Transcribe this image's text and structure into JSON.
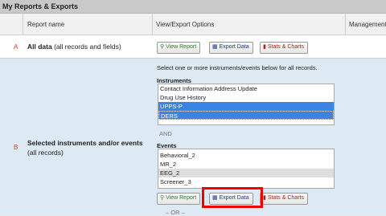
{
  "title": "My Reports & Exports",
  "columns": {
    "report_name": "Report name",
    "view_export": "View/Export Options",
    "management": "Management"
  },
  "rows": {
    "a": {
      "letter": "A",
      "name_bold": "All data",
      "name_rest": " (all records and fields)"
    },
    "b": {
      "letter": "B",
      "name_bold": "Selected instruments and/or events",
      "name_rest": "(all records)"
    }
  },
  "buttons": {
    "view_report": "View Report",
    "export_data": "Export Data",
    "stats_charts": "Stats & Charts"
  },
  "selection": {
    "instructions": "Select one or more instruments/events below for all records.",
    "instruments_label": "Instruments",
    "instruments": [
      {
        "label": "Contact Information Address Update",
        "selected": false
      },
      {
        "label": "Drug Use History",
        "selected": false
      },
      {
        "label": "UPPS-P",
        "selected": true
      },
      {
        "label": "DERS",
        "selected": true
      }
    ],
    "and_label": "AND",
    "events_label": "Events",
    "events": [
      {
        "label": "Behavioral_2",
        "state": "none"
      },
      {
        "label": "MR_2",
        "state": "none"
      },
      {
        "label": "EEG_2",
        "state": "highlighted"
      },
      {
        "label": "Screener_3",
        "state": "none"
      }
    ],
    "or_label": "– OR –"
  },
  "colors": {
    "row_b_background": "#dde9f3",
    "selected_option": "#3a84e5",
    "row_letter": "#c8402f",
    "highlight_box": "#ee0000"
  },
  "icons": {
    "view_report": "magnifier-icon",
    "export_data": "document-icon",
    "stats_charts": "bar-chart-icon"
  }
}
